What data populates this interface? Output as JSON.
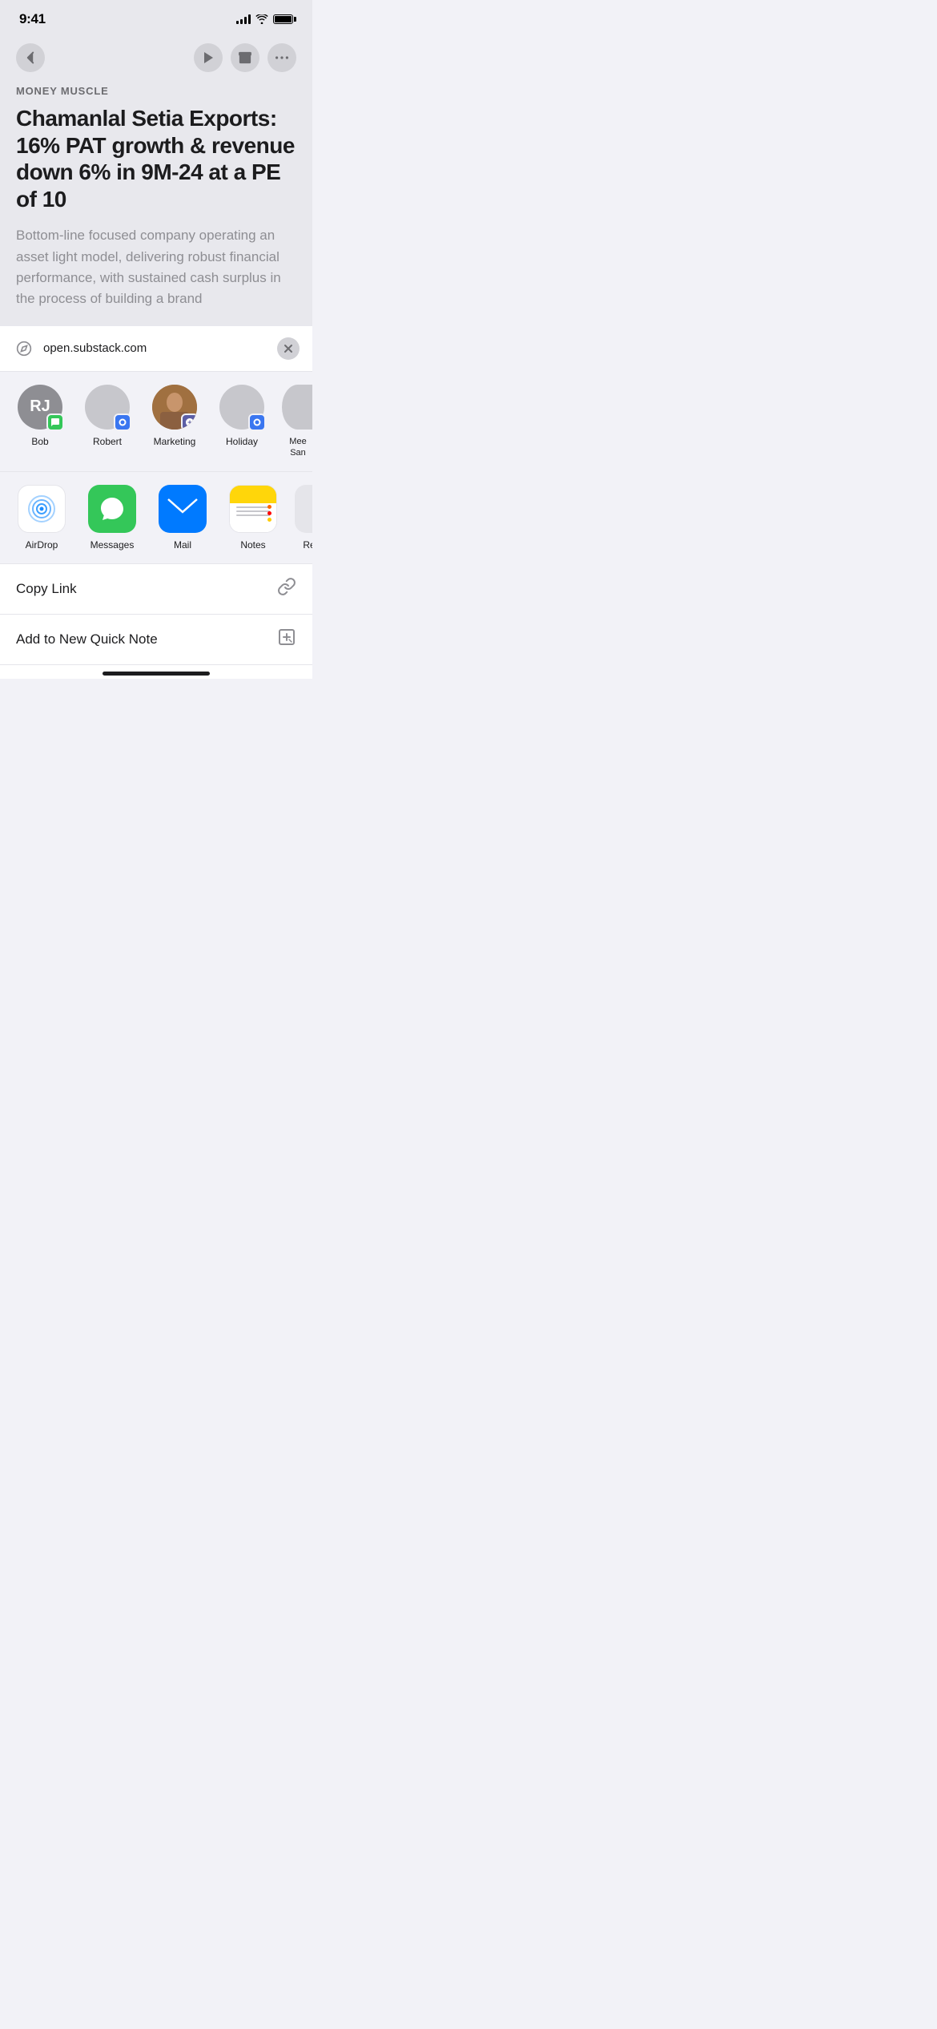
{
  "statusBar": {
    "time": "9:41",
    "signalBars": [
      3,
      5,
      7,
      9,
      11
    ],
    "batteryFull": true
  },
  "navBar": {
    "backButton": "‹",
    "playButton": "▶",
    "archiveButton": "⬛",
    "moreButton": "•••"
  },
  "article": {
    "category": "MONEY MUSCLE",
    "title": "Chamanlal Setia Exports: 16% PAT growth & revenue down 6% in 9M-24 at a PE of 10",
    "subtitle": "Bottom-line focused company operating an asset light model, delivering robust financial performance, with sustained cash surplus in the process of building a brand"
  },
  "shareSheet": {
    "url": "open.substack.com",
    "contacts": [
      {
        "name": "Bob",
        "initials": "RJ",
        "badgeApp": "messages",
        "color": "gray"
      },
      {
        "name": "Robert",
        "initials": "",
        "badgeApp": "signal",
        "color": "light-gray"
      },
      {
        "name": "Marketing",
        "initials": "",
        "badgeApp": "teams",
        "color": "photo",
        "hasPhoto": true
      },
      {
        "name": "Holiday",
        "initials": "",
        "badgeApp": "signal",
        "color": "light-gray"
      },
      {
        "name": "Mee San",
        "initials": "",
        "badgeApp": "signal",
        "color": "partial"
      }
    ],
    "apps": [
      {
        "name": "AirDrop",
        "type": "airdrop"
      },
      {
        "name": "Messages",
        "type": "messages"
      },
      {
        "name": "Mail",
        "type": "mail"
      },
      {
        "name": "Notes",
        "type": "notes"
      },
      {
        "name": "Re",
        "type": "partial"
      }
    ],
    "actions": [
      {
        "label": "Copy Link",
        "icon": "link"
      },
      {
        "label": "Add to New Quick Note",
        "icon": "quicknote"
      }
    ]
  }
}
